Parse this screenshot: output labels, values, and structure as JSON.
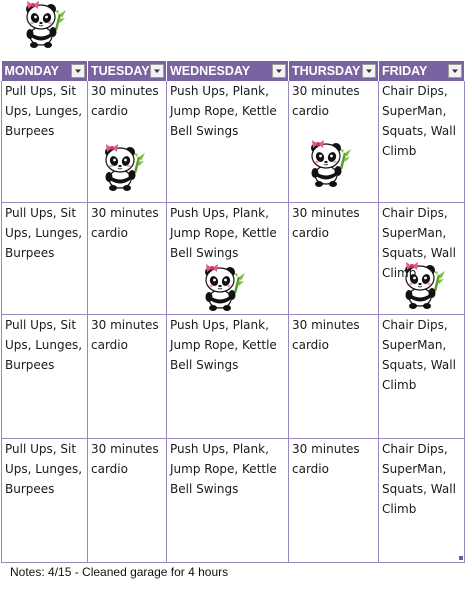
{
  "table": {
    "headers": [
      "MONDAY",
      "TUESDAY",
      "WEDNESDAY",
      "THURSDAY",
      "FRIDAY"
    ],
    "rows": [
      [
        "Pull Ups, Sit Ups, Lunges, Burpees",
        "30 minutes cardio",
        "Push Ups, Plank, Jump Rope, Kettle Bell Swings",
        "30 minutes cardio",
        "Chair Dips, SuperMan, Squats, Wall Climb"
      ],
      [
        "Pull Ups, Sit Ups, Lunges, Burpees",
        "30 minutes cardio",
        "Push Ups, Plank, Jump Rope, Kettle Bell Swings",
        "30 minutes cardio",
        "Chair Dips, SuperMan, Squats, Wall Climb"
      ],
      [
        "Pull Ups, Sit Ups, Lunges, Burpees",
        "30 minutes cardio",
        "Push Ups, Plank, Jump Rope, Kettle Bell Swings",
        "30 minutes cardio",
        "Chair Dips, SuperMan, Squats, Wall Climb"
      ],
      [
        "Pull Ups, Sit Ups, Lunges, Burpees",
        "30 minutes cardio",
        "Push Ups, Plank, Jump Rope, Kettle Bell Swings",
        "30 minutes cardio",
        "Chair Dips, SuperMan, Squats, Wall Climb"
      ]
    ],
    "filter_icon": "dropdown-arrow-icon"
  },
  "decorations": {
    "sticker_icon": "panda-icon",
    "colors": {
      "header_bg": "#7b62a0",
      "header_text": "#ffffff",
      "grid_line": "#9b86bd",
      "bow": "#e8588a",
      "bamboo": "#7cbf3a"
    }
  },
  "notes": {
    "text": "Notes: 4/15 - Cleaned garage for 4 hours"
  }
}
